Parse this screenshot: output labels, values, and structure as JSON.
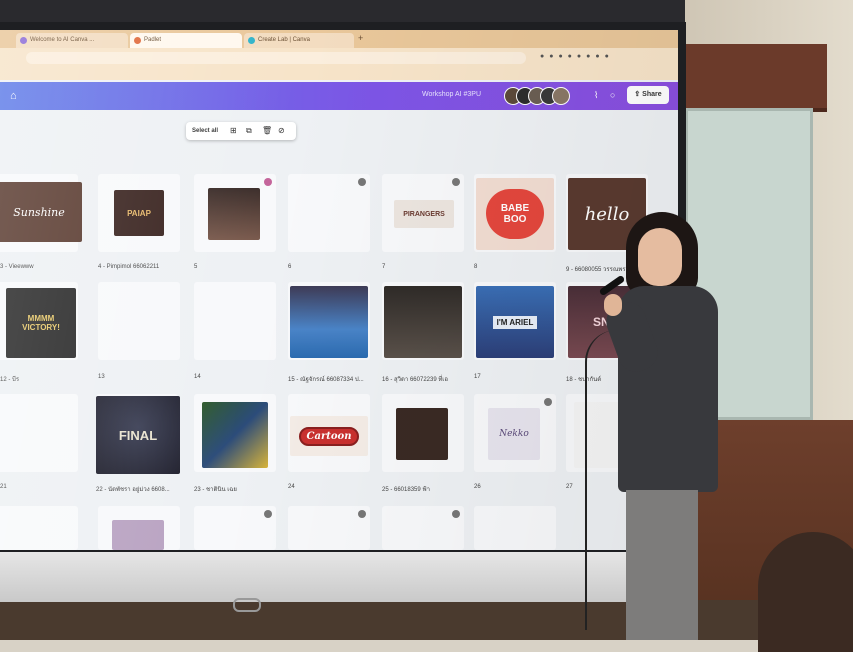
{
  "browser": {
    "tabs": [
      {
        "label": "Welcome to AI Canva ..."
      },
      {
        "label": "Padlet"
      },
      {
        "label": "Create Lab | Canva"
      }
    ],
    "new_tab": "+"
  },
  "canva": {
    "home_icon": "home-icon",
    "title": "Workshop AI #3PU",
    "share_label": "Share"
  },
  "selection_toolbar": {
    "select_all": "Select all",
    "icons": [
      "add-page-icon",
      "duplicate-icon",
      "trash-icon",
      "hide-icon"
    ]
  },
  "pages": [
    {
      "caption": "3 - Vieewww",
      "art": "Sunshine"
    },
    {
      "caption": "4 - Pimpimol 66062211",
      "art": "PAIAP"
    },
    {
      "caption": "5",
      "art": ""
    },
    {
      "caption": "6",
      "art": ""
    },
    {
      "caption": "7",
      "art": "PIRANGERS"
    },
    {
      "caption": "8",
      "art": "BABE BOO"
    },
    {
      "caption": "9 - 66080055 วรรณพร",
      "art": "hello"
    },
    {
      "caption": "12 - บีร",
      "art": "MMMM VICTORY!"
    },
    {
      "caption": "13",
      "art": ""
    },
    {
      "caption": "14",
      "art": ""
    },
    {
      "caption": "15 - ณัฐจักรณ์ 66087334 ป...",
      "art": ""
    },
    {
      "caption": "16 - สุวิดา 66072239 ที่เอ",
      "art": ""
    },
    {
      "caption": "17",
      "art": "I'M ARIEL"
    },
    {
      "caption": "18 - ชนากันต์",
      "art": "SNI"
    },
    {
      "caption": "21",
      "art": ""
    },
    {
      "caption": "22 - นัดพัชรา อยู่ม่วง 6608...",
      "art": "FINAL"
    },
    {
      "caption": "23 - ชาตินิน เฉย",
      "art": ""
    },
    {
      "caption": "24",
      "art": "Cartoon"
    },
    {
      "caption": "25 - 66018359 ฟ้า",
      "art": ""
    },
    {
      "caption": "26",
      "art": "Nekko"
    },
    {
      "caption": "27",
      "art": ""
    }
  ],
  "colors": {
    "canva_header_start": "#5f7de8",
    "canva_header_end": "#8b4fe0"
  }
}
